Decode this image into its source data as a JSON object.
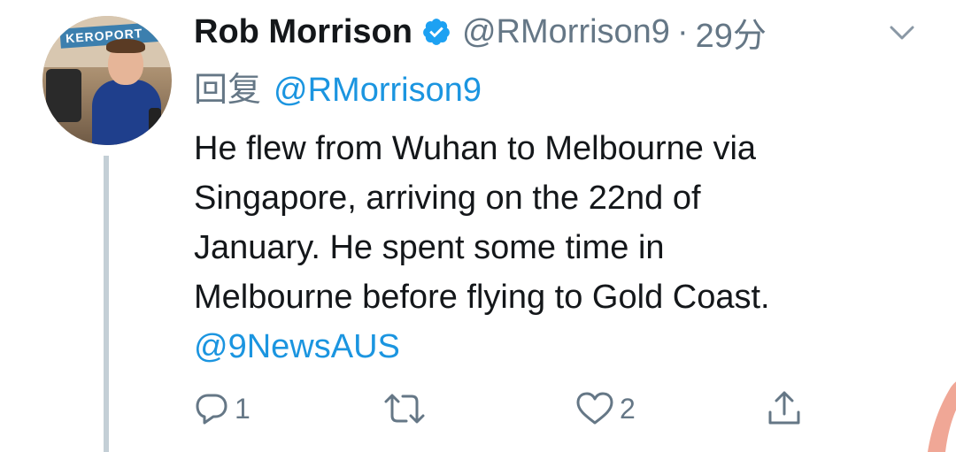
{
  "tweet": {
    "author_name": "Rob Morrison",
    "handle": "@RMorrison9",
    "separator": "·",
    "time": "29分",
    "reply_label": "回复",
    "reply_to": "@RMorrison9",
    "body_lines": [
      "He flew from Wuhan to Melbourne via",
      "Singapore, arriving on the 22nd of",
      "January. He spent some time in",
      "Melbourne before flying to Gold Coast."
    ],
    "mention": "@9NewsAUS",
    "avatar_sign_text": "KEROPORT",
    "actions": {
      "reply_count": "1",
      "retweet_count": "",
      "like_count": "2"
    }
  },
  "icons": {
    "verified": "verified-badge-icon",
    "chevron": "chevron-down-icon",
    "reply": "reply-bubble-icon",
    "retweet": "retweet-icon",
    "like": "heart-icon",
    "share": "share-icon"
  },
  "colors": {
    "link_blue": "#1b95e0",
    "verified_blue": "#1da1f2",
    "secondary_gray": "#657786",
    "thread_line": "#c4cfd6"
  }
}
